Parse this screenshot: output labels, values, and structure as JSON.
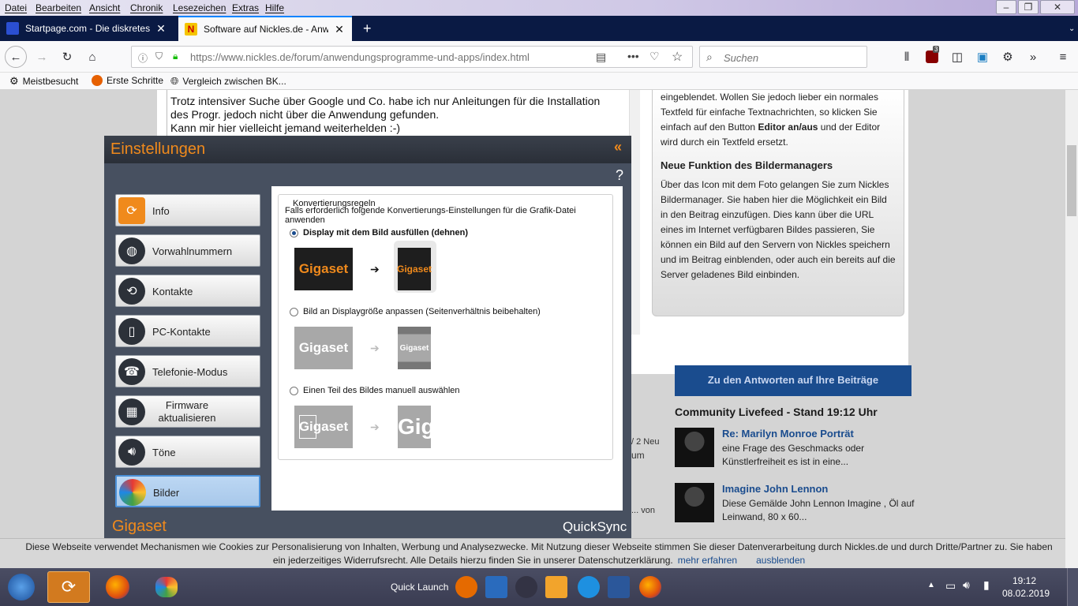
{
  "menubar": {
    "items": [
      "Datei",
      "Bearbeiten",
      "Ansicht",
      "Chronik",
      "Lesezeichen",
      "Extras",
      "Hilfe"
    ]
  },
  "tabs": [
    {
      "title": "Startpage.com - Die diskreteste",
      "active": false
    },
    {
      "title": "Software auf Nickles.de - Anwe",
      "active": true
    }
  ],
  "nav": {
    "url": "https://www.nickles.de/forum/anwendungsprogramme-und-apps/index.html",
    "search_placeholder": "Suchen",
    "badge": "3"
  },
  "bookmarks": [
    "Meistbesucht",
    "Erste Schritte",
    "Vergleich zwischen BK..."
  ],
  "editor": {
    "lines": [
      "Trotz intensiver Suche über Google und Co. habe ich nur Anleitungen für die Installation",
      "des Progr. jedoch nicht über die Anwendung gefunden.",
      "Kann mir hier vielleicht jemand weiterhelden :-)"
    ]
  },
  "sidebox": {
    "para1": "eingeblendet. Wollen Sie jedoch lieber ein normales Textfeld für einfache Textnachrichten, so klicken Sie einfach auf den Button",
    "para1_bold": "Editor an/aus",
    "para1_end": "und der Editor wird durch ein Textfeld ersetzt.",
    "heading": "Neue Funktion des Bildermanagers",
    "para2": "Über das Icon mit dem Foto gelangen Sie zum Nickles Bildermanager. Sie haben hier die Möglichkeit ein Bild in den Beitrag einzufügen. Dies kann über die URL eines im Internet verfügbaren Bildes passieren, Sie können ein Bild auf den Servern von Nickles speichern und im Beitrag einblenden, oder auch ein bereits auf die Server geladenes Bild einbinden."
  },
  "right": {
    "antworten_button": "Zu den Antworten auf Ihre Beiträge",
    "livefeed_title": "Community Livefeed - Stand 19:12 Uhr",
    "feed": [
      {
        "title": "Re: Marilyn Monroe Porträt",
        "desc": "eine Frage des Geschmacks oder Künstlerfreiheit es ist in eine..."
      },
      {
        "title": "Imagine John Lennon",
        "desc": "Diese Gemälde John Lennon Imagine , Öl auf Leinwand, 80 x 60..."
      }
    ],
    "fragments": [
      "/ 2 Neu",
      "um",
      "... von"
    ]
  },
  "dialog": {
    "title": "Einstellungen",
    "collapse_icon": "«",
    "help": "?",
    "nav": [
      {
        "label": "Info",
        "icon": "sync-orange-icon"
      },
      {
        "label": "Vorwahlnummern",
        "icon": "globe-icon"
      },
      {
        "label": "Kontakte",
        "icon": "sync-icon"
      },
      {
        "label": "PC-Kontakte",
        "icon": "book-icon"
      },
      {
        "label": "Telefonie-Modus",
        "icon": "phone-icon"
      },
      {
        "label": "Firmware aktualisieren",
        "icon": "chip-icon"
      },
      {
        "label": "Töne",
        "icon": "speaker-icon"
      },
      {
        "label": "Bilder",
        "icon": "pictures-icon",
        "selected": true
      }
    ],
    "group_label": "Konvertierungsregeln",
    "description": "Falls erforderlich folgende Konvertierungs-Einstellungen für die Grafik-Datei anwenden",
    "options": [
      {
        "label": "Display mit dem Bild ausfüllen (dehnen)",
        "checked": true
      },
      {
        "label": "Bild an Displaygröße anpassen (Seitenverhältnis beibehalten)",
        "checked": false
      },
      {
        "label": "Einen Teil des Bildes manuell auswählen",
        "checked": false
      }
    ],
    "sample_text": "Gigaset",
    "sample_crop": "Gig",
    "brand": "Gigaset",
    "app": "QuickSync"
  },
  "cookie": {
    "text1": "Diese Webseite verwendet Mechanismen wie Cookies zur Personalisierung von Inhalten, Werbung und Analysezwecke. Mit Nutzung dieser Webseite stimmen Sie dieser Datenverarbeitung durch Nickles.de und durch Dritte/Partner zu. Sie haben",
    "text2": "ein jederzeitiges Widerrufsrecht. Alle Details hierzu finden Sie in unserer Datenschutzerklärung.",
    "more": "mehr erfahren",
    "hide": "ausblenden"
  },
  "taskbar": {
    "quick_launch": "Quick Launch",
    "time": "19:12",
    "date": "08.02.2019"
  },
  "colors": {
    "accent": "#f08a1c",
    "link": "#1a4c8e",
    "dialog_bg": "#475060"
  }
}
